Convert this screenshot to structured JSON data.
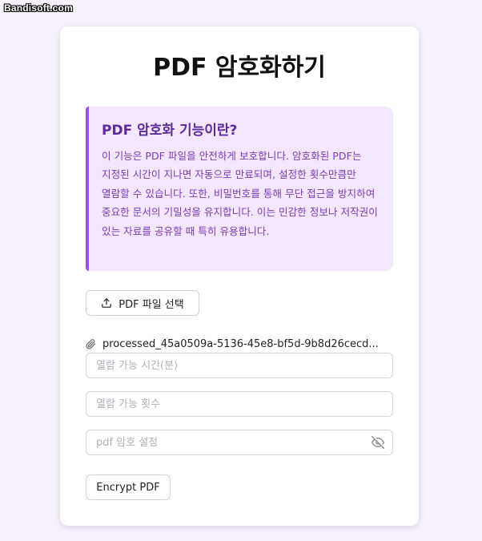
{
  "watermark": "Bandisoft.com",
  "page": {
    "title": "PDF 암호화하기"
  },
  "info": {
    "title": "PDF 암호화 기능이란?",
    "body": "이 기능은 PDF 파일을 안전하게 보호합니다. 암호화된 PDF는 지정된 시간이 지나면 자동으로 만료되며, 설정한 횟수만큼만 열람할 수 있습니다. 또한, 비밀번호를 통해 무단 접근을 방지하여 중요한 문서의 기밀성을 유지합니다. 이는 민감한 정보나 저작권이 있는 자료를 공유할 때 특히 유용합니다."
  },
  "upload": {
    "button_label": "PDF 파일 선택",
    "icon": "upload-icon"
  },
  "file": {
    "icon": "paperclip-icon",
    "name": "processed_45a0509a-5136-45e8-bf5d-9b8d26cecd..."
  },
  "fields": {
    "time_placeholder": "열람 가능 시간(분)",
    "count_placeholder": "열람 가능 횟수",
    "password_placeholder": "pdf 암호 설정",
    "password_toggle_icon": "eye-off-icon"
  },
  "actions": {
    "encrypt_label": "Encrypt PDF"
  },
  "colors": {
    "background": "#f7f1fc",
    "info_background": "#f3e6fd",
    "info_accent": "#9a55d8",
    "info_title": "#5e2a9c",
    "info_text": "#7a3cb6"
  }
}
